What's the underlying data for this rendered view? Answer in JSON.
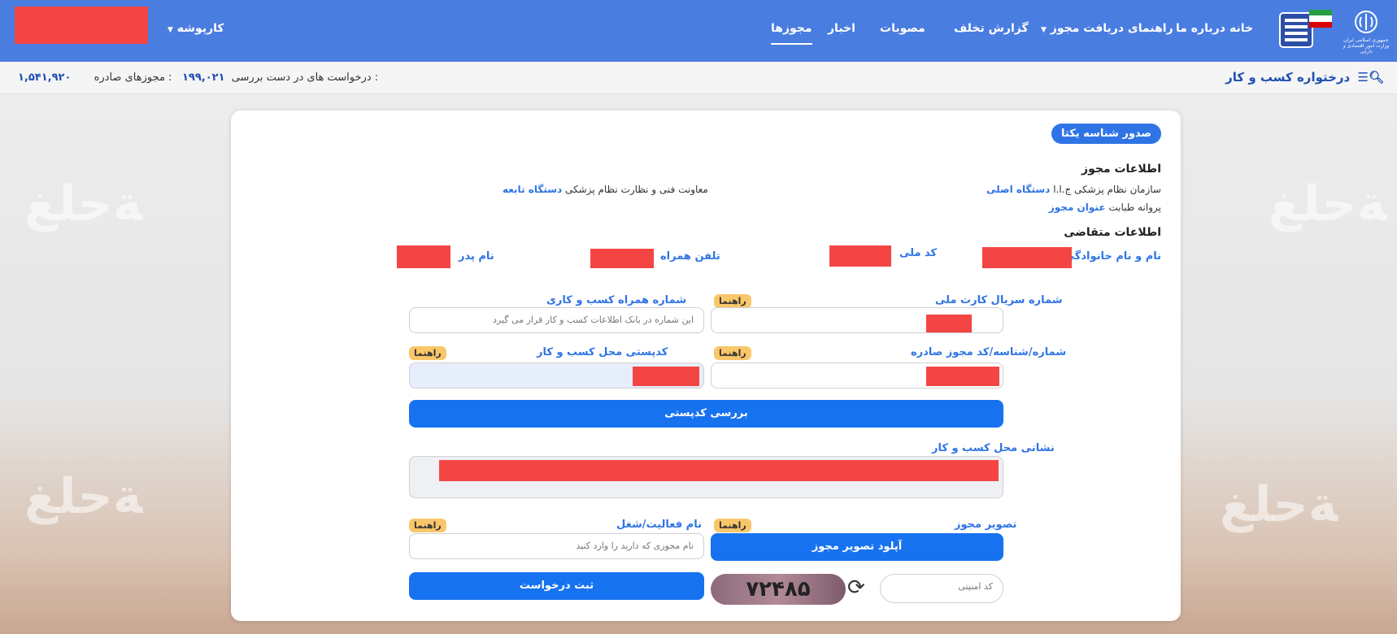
{
  "nav": {
    "items": [
      {
        "label": "خانه"
      },
      {
        "label": "درباره ما"
      },
      {
        "label": "راهنمای دریافت مجوز"
      },
      {
        "label": "گزارش تخلف"
      },
      {
        "label": "مصوبات"
      },
      {
        "label": "اخبار"
      },
      {
        "label": "مجوزها"
      }
    ],
    "desk": "کارپوشه",
    "ministry_logo_text": "جمهوری اسلامی ایران وزارت امور اقتصادی و دارایی"
  },
  "subbar": {
    "biz_link": "درختواره کسب و کار",
    "in_review_label": "درخواست های در دست بررسی :",
    "in_review_value": "۱۹۹,۰۲۱",
    "issued_label": "مجوزهای صادره :",
    "issued_value": "۱,۵۴۱,۹۲۰"
  },
  "card": {
    "title_pill": "صدور شناسه یکتا",
    "license_info_heading": "اطلاعات مجوز",
    "main_org_key": "دستگاه اصلی",
    "main_org_val": "سازمان نظام پزشکی ج.ا.ا",
    "sub_org_key": "دستگاه تابعه",
    "sub_org_val": "معاونت فنی و نظارت نظام پزشکی",
    "license_title_key": "عنوان مجوز",
    "license_title_val": "پروانه طبابت",
    "applicant_heading": "اطلاعات متقاضی",
    "full_name": "نام و نام خانوادگی",
    "national_code": "کد ملی",
    "mobile": "تلفن همراه",
    "father_name": "نام پدر"
  },
  "form": {
    "help": "راهنما",
    "id_card_serial_label": "شماره سریال کارت ملی",
    "biz_mobile_label": "شماره همراه کسب و کاری",
    "biz_mobile_placeholder": "این شماره در بانک اطلاعات کسب و کار قرار می گیرد",
    "issued_license_label": "شماره/شناسه/کد مجوز صادره",
    "postal_code_label": "کدپستی محل کسب و کار",
    "check_postal_btn": "بررسی کدپستی",
    "address_label": "نشانی محل کسب و کار",
    "license_image_label": "تصویر مجوز",
    "upload_btn": "آپلود تصویر مجوز",
    "activity_label": "نام فعالیت/شغل",
    "activity_placeholder": "نام مجوزی که دارید را وارد کنید",
    "captcha_placeholder": "کد امنیتی",
    "captcha_text": "۷۲۴۸۵",
    "submit_btn": "ثبت درخواست"
  },
  "colors": {
    "primary": "#1772f0",
    "nav": "#4a7de0",
    "redact": "#f44545",
    "badge": "#f9c76a"
  }
}
